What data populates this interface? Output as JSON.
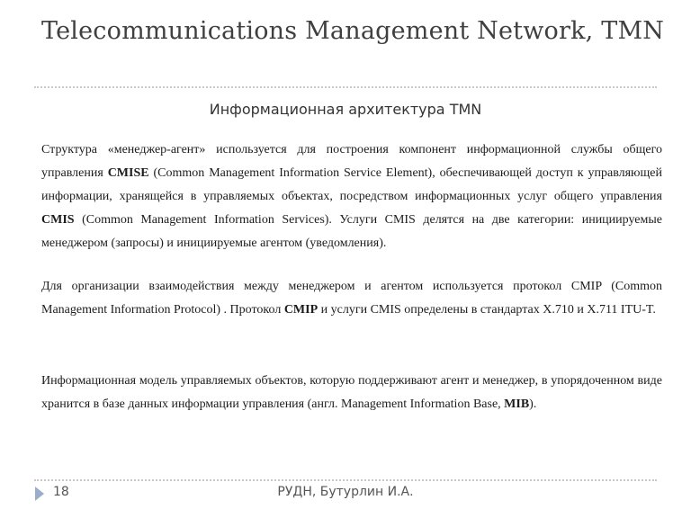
{
  "slide": {
    "title": "Telecommunications Management Network, TMN",
    "subtitle": "Информационная архитектура TMN"
  },
  "paragraphs": {
    "p1": {
      "s1": "Структура «менеджер-агент» используется для построения компонент информационной службы общего управления ",
      "b1": "CMISE",
      "s2": " (Common Management Information Service Element), обеспечивающей доступ к управляющей информации, хранящейся в управляемых объектах, посредством информационных услуг общего управления ",
      "b2": "CMIS",
      "s3": " (Common Management Information Services). Услуги CMIS делятся на две категории: инициируемые менеджером (запросы) и инициируемые агентом (уведомления)."
    },
    "p2": {
      "s1": "Для организации взаимодействия между менеджером и агентом используется протокол CMIP (Common Management Information Protocol) . Протокол ",
      "b1": "CMIP",
      "s2": " и услуги CMIS определены в стандартах X.710 и X.711 ITU-T."
    },
    "p3": {
      "s1": "Информационная модель управляемых объектов, которую поддерживают агент и менеджер, в упорядоченном виде хранится в базе данных информации управления (англ. Management Information Base, ",
      "b1": "MIB",
      "s2": ")."
    }
  },
  "footer": {
    "page_number": "18",
    "author": "РУДН, Бутурлин И.А.",
    "arrow_icon": "triangle-right-icon",
    "accent_color": "#9aaec9"
  }
}
